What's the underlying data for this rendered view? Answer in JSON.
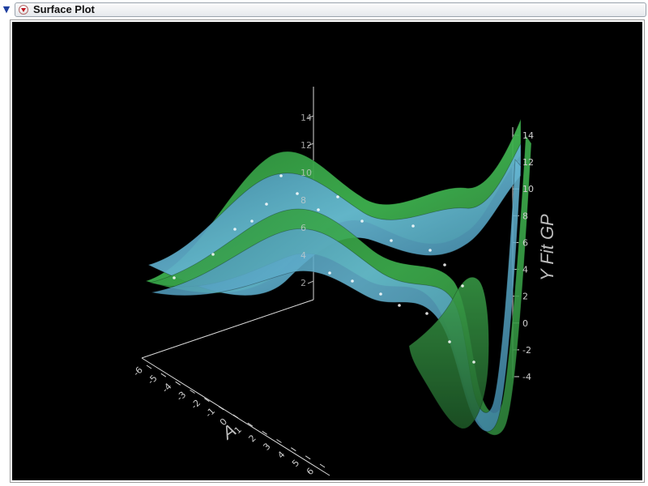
{
  "window": {
    "title": "Surface Plot"
  },
  "icons": {
    "disclosure": "disclosure-triangle-icon",
    "menu": "red-triangle-menu-icon"
  },
  "plot": {
    "background": "#000000",
    "surface_colors": {
      "green": "#3fa24a",
      "blue": "#5aa9c8"
    }
  },
  "chart_data": {
    "type": "area",
    "title": "",
    "z_axis_label": "Y Fit GP",
    "x_axis_label": "A",
    "z_ticks": [
      "-4",
      "-2",
      "0",
      "2",
      "4",
      "6",
      "8",
      "10",
      "12",
      "14"
    ],
    "a_ticks": [
      "-6",
      "-5",
      "-4",
      "-3",
      "-2",
      "-1",
      "0",
      "1",
      "2",
      "3",
      "4",
      "5",
      "6"
    ],
    "back_axis_ticks": [
      "2",
      "4",
      "6",
      "8",
      "10",
      "12",
      "14"
    ],
    "grid": false
  }
}
